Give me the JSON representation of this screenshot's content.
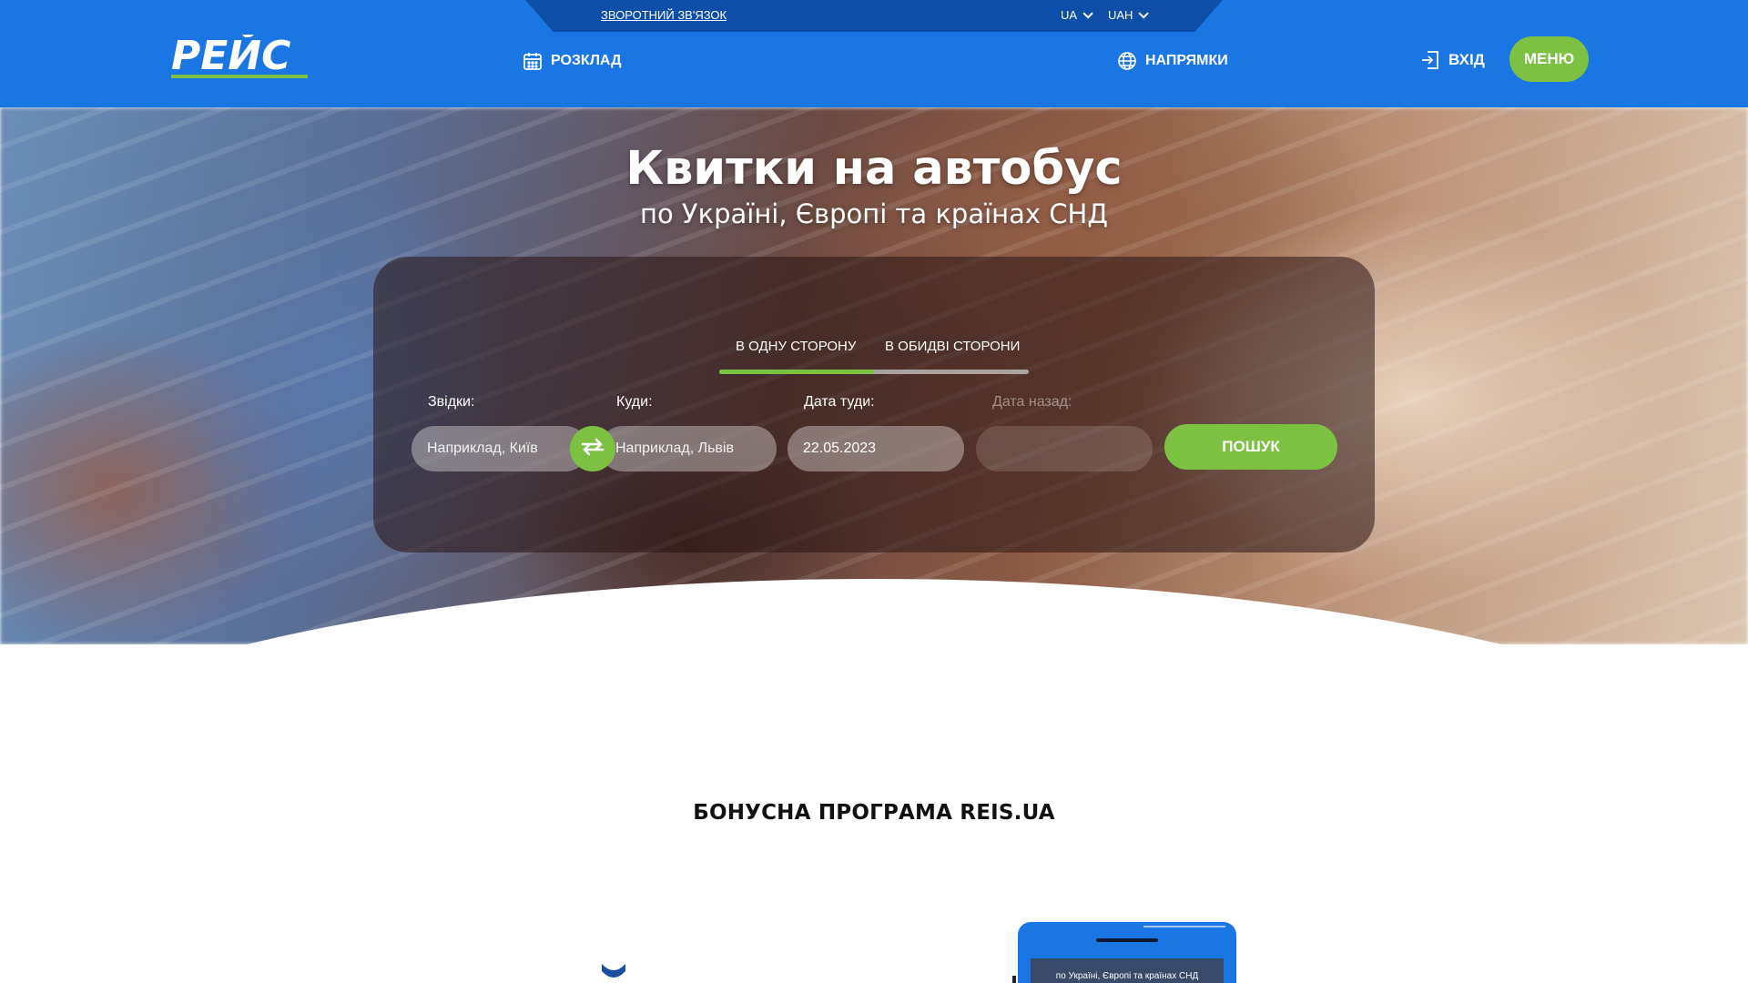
{
  "topbar": {
    "feedback_link": "ЗВОРОТНИЙ ЗВ'ЯЗОК",
    "language": "UA",
    "currency": "UAH"
  },
  "header": {
    "logo_text": "РЕЙС",
    "nav": {
      "schedule": "РОЗКЛАД",
      "directions": "НАПРЯМКИ",
      "login": "ВХІД"
    },
    "menu_button": "МЕНЮ"
  },
  "hero": {
    "title": "Квитки на автобус",
    "subtitle": "по Україні, Європі та країнах СНД"
  },
  "search": {
    "tabs": [
      {
        "label": "В ОДНУ СТОРОНУ",
        "active": true
      },
      {
        "label": "В ОБИДВІ СТОРОНИ",
        "active": false
      }
    ],
    "from_label": "Звідки:",
    "from_placeholder": "Наприклад, Київ",
    "to_label": "Куди:",
    "to_placeholder": "Наприклад, Львів",
    "date_there_label": "Дата туди:",
    "date_there_value": "22.05.2023",
    "date_back_label": "Дата назад:",
    "date_back_value": "",
    "search_button": "ПОШУК"
  },
  "bonus": {
    "title": "БОНУСНА ПРОГРАМА REIS.UA",
    "phone_text": "по Україні, Європі та країнах СНД"
  },
  "colors": {
    "brand_blue": "#1976e3",
    "topbar_blue": "#0d4fa8",
    "accent_green": "#7dc142"
  }
}
